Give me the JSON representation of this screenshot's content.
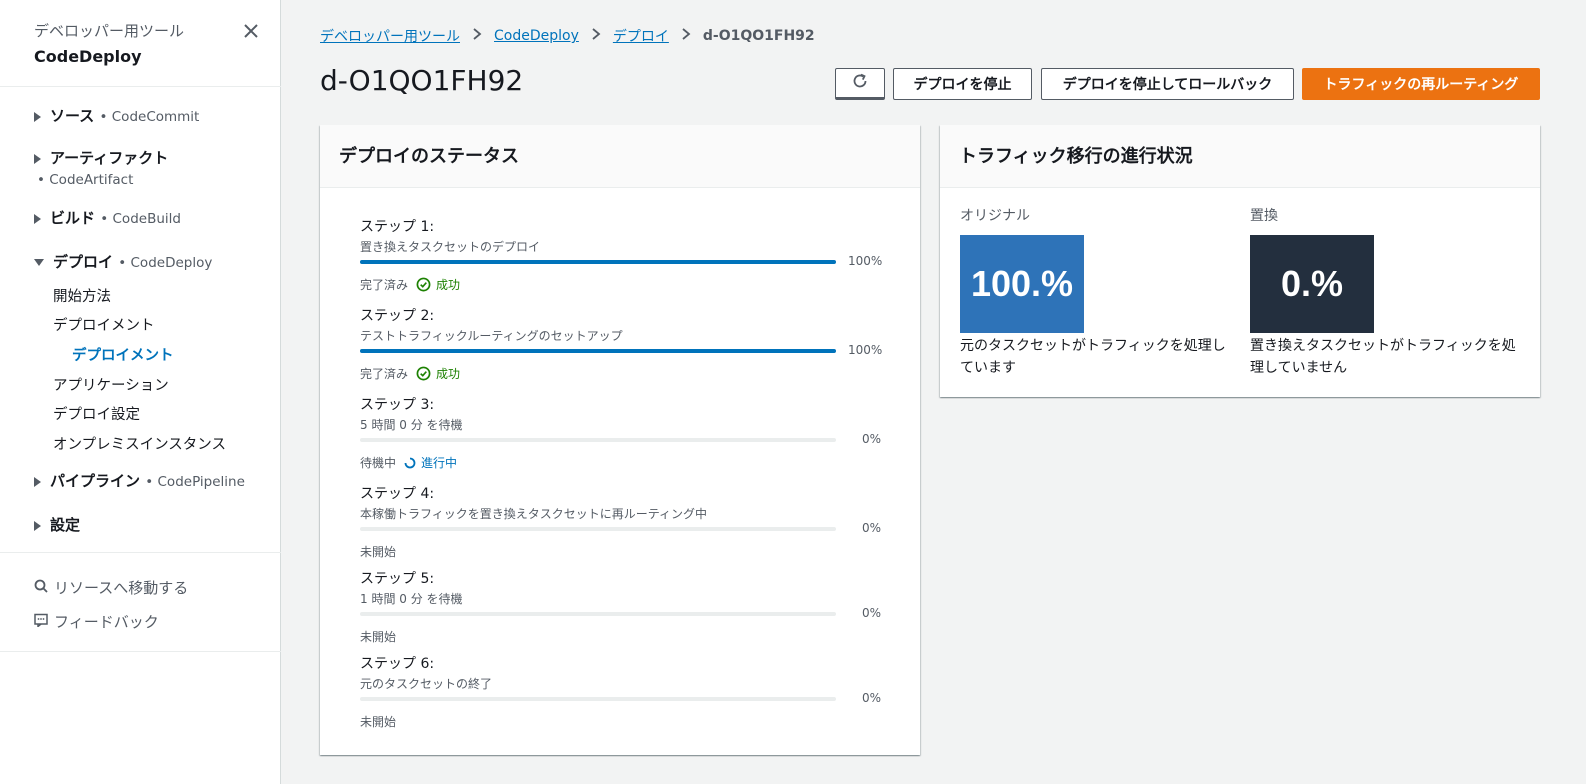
{
  "sidebar": {
    "subtitle": "デベロッパー用ツール",
    "title": "CodeDeploy",
    "sections": [
      {
        "label": "ソース",
        "service": "• CodeCommit"
      },
      {
        "label": "アーティファクト",
        "service": "• CodeArtifact"
      },
      {
        "label": "ビルド",
        "service": "• CodeBuild"
      },
      {
        "label": "デプロイ",
        "service": "• CodeDeploy"
      },
      {
        "label": "パイプライン",
        "service": "• CodePipeline"
      },
      {
        "label": "設定",
        "service": ""
      }
    ],
    "deploy_links": [
      "開始方法",
      "デプロイメント",
      "デプロイメント",
      "アプリケーション",
      "デプロイ設定",
      "オンプレミスインスタンス"
    ],
    "util": {
      "goto_resource": "リソースへ移動する",
      "feedback": "フィードバック"
    }
  },
  "breadcrumb": {
    "items": [
      "デベロッパー用ツール",
      "CodeDeploy",
      "デプロイ"
    ],
    "current": "d-O1QO1FH92"
  },
  "page": {
    "title": "d-O1QO1FH92"
  },
  "actions": {
    "stop": "デプロイを停止",
    "stop_rollback": "デプロイを停止してロールバック",
    "reroute": "トラフィックの再ルーティング",
    "primary_color": "#ec7211"
  },
  "status": {
    "title": "デプロイのステータス",
    "steps": [
      {
        "title": "ステップ 1:",
        "desc": "置き換えタスクセットのデプロイ",
        "progress": 100,
        "pct": "100%",
        "state": "完了済み",
        "result": "成功"
      },
      {
        "title": "ステップ 2:",
        "desc": "テストトラフィックルーティングのセットアップ",
        "progress": 100,
        "pct": "100%",
        "state": "完了済み",
        "result": "成功"
      },
      {
        "title": "ステップ 3:",
        "desc": "5 時間 0 分 を待機",
        "progress": 0,
        "pct": "0%",
        "state": "待機中",
        "result": "進行中"
      },
      {
        "title": "ステップ 4:",
        "desc": "本稼働トラフィックを置き換えタスクセットに再ルーティング中",
        "progress": 0,
        "pct": "0%",
        "state": "未開始",
        "result": ""
      },
      {
        "title": "ステップ 5:",
        "desc": "1 時間 0 分 を待機",
        "progress": 0,
        "pct": "0%",
        "state": "未開始",
        "result": ""
      },
      {
        "title": "ステップ 6:",
        "desc": "元のタスクセットの終了",
        "progress": 0,
        "pct": "0%",
        "state": "未開始",
        "result": ""
      }
    ]
  },
  "traffic": {
    "title": "トラフィック移行の進行状況",
    "original": {
      "label": "オリジナル",
      "value": "100.%",
      "desc": "元のタスクセットがトラフィックを処理しています",
      "color": "#2e73b8"
    },
    "replacement": {
      "label": "置換",
      "value": "0.%",
      "desc": "置き換えタスクセットがトラフィックを処理していません",
      "color": "#232f3e"
    }
  }
}
